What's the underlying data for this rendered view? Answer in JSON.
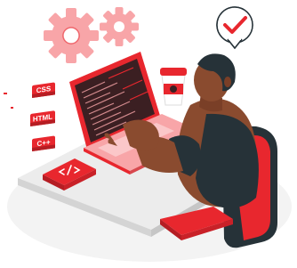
{
  "illustration": {
    "tags": {
      "css": "CSS",
      "html": "HTML",
      "cpp": "C++"
    },
    "colors": {
      "accent": "#e8272e",
      "accent_light": "#f8a5a8",
      "skin": "#8a4b2f",
      "hair": "#263238",
      "desk": "#e9e9e9",
      "floor": "#f1f1f1"
    },
    "icons": [
      "gear-icon",
      "check-badge-icon",
      "code-book-icon"
    ]
  }
}
